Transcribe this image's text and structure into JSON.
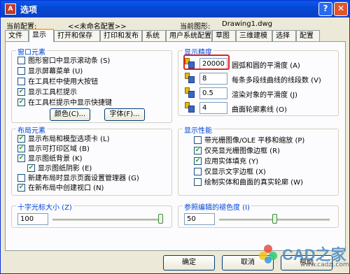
{
  "window": {
    "title": "选项",
    "help_glyph": "?",
    "close_glyph": "✕"
  },
  "config": {
    "current_profile_label": "当前配置:",
    "current_profile_value": "<<未命名配置>>",
    "current_drawing_label": "当前图形:",
    "current_drawing_value": "Drawing1.dwg"
  },
  "tabs": [
    "文件",
    "显示",
    "打开和保存",
    "打印和发布",
    "系统",
    "用户系统配置",
    "草图",
    "三维建模",
    "选择",
    "配置"
  ],
  "active_tab": "显示",
  "window_elements": {
    "title": "窗口元素",
    "items": [
      {
        "label": "图形窗口中显示滚动条 (S)",
        "checked": false
      },
      {
        "label": "显示屏幕菜单 (U)",
        "checked": false
      },
      {
        "label": "在工具栏中使用大按钮",
        "checked": false
      },
      {
        "label": "显示工具栏提示",
        "checked": true
      },
      {
        "label": "在工具栏提示中显示快捷键",
        "checked": true
      }
    ],
    "color_button": "颜色(C)...",
    "font_button": "字体(F)..."
  },
  "layout_elements": {
    "title": "布局元素",
    "items": [
      {
        "label": "显示布局和模型选项卡 (L)",
        "checked": true
      },
      {
        "label": "显示可打印区域 (B)",
        "checked": true
      },
      {
        "label": "显示图纸背景 (K)",
        "checked": true
      },
      {
        "label": "显示图纸阴影 (E)",
        "checked": true
      },
      {
        "label": "新建布局时显示页面设置管理器 (G)",
        "checked": false
      },
      {
        "label": "在新布局中创建视口 (N)",
        "checked": true
      }
    ]
  },
  "crosshair": {
    "title": "十字光标大小 (Z)",
    "value": "100",
    "level": 1.0
  },
  "display_resolution": {
    "title": "显示精度",
    "items": [
      {
        "value": "20000",
        "label": "圆弧和圆的平滑度 (A)"
      },
      {
        "value": "8",
        "label": "每条多段线曲线的线段数 (V)"
      },
      {
        "value": "0.5",
        "label": "渲染对象的平滑度 (J)"
      },
      {
        "value": "4",
        "label": "曲面轮廓素线 (O)"
      }
    ]
  },
  "display_performance": {
    "title": "显示性能",
    "items": [
      {
        "label": "带光栅图像/OLE 平移和缩放 (P)",
        "checked": false
      },
      {
        "label": "仅亮显光栅图像边框 (R)",
        "checked": true
      },
      {
        "label": "应用实体填充 (Y)",
        "checked": true
      },
      {
        "label": "仅显示文字边框 (X)",
        "checked": false
      },
      {
        "label": "绘制实体和曲面的真实轮廓 (W)",
        "checked": false
      }
    ]
  },
  "xref_fade": {
    "title": "参照编辑的褪色度 (I)",
    "value": "50",
    "level": 0.5
  },
  "buttons": {
    "ok": "确定",
    "cancel": "取消",
    "help": "帮助"
  },
  "watermark": {
    "text": "CAD之家",
    "url": "www.cadzj.com"
  },
  "colors": {
    "accent_label": "#0046d5",
    "title_bar": "#0a5ae8",
    "highlight": "#e02020"
  }
}
